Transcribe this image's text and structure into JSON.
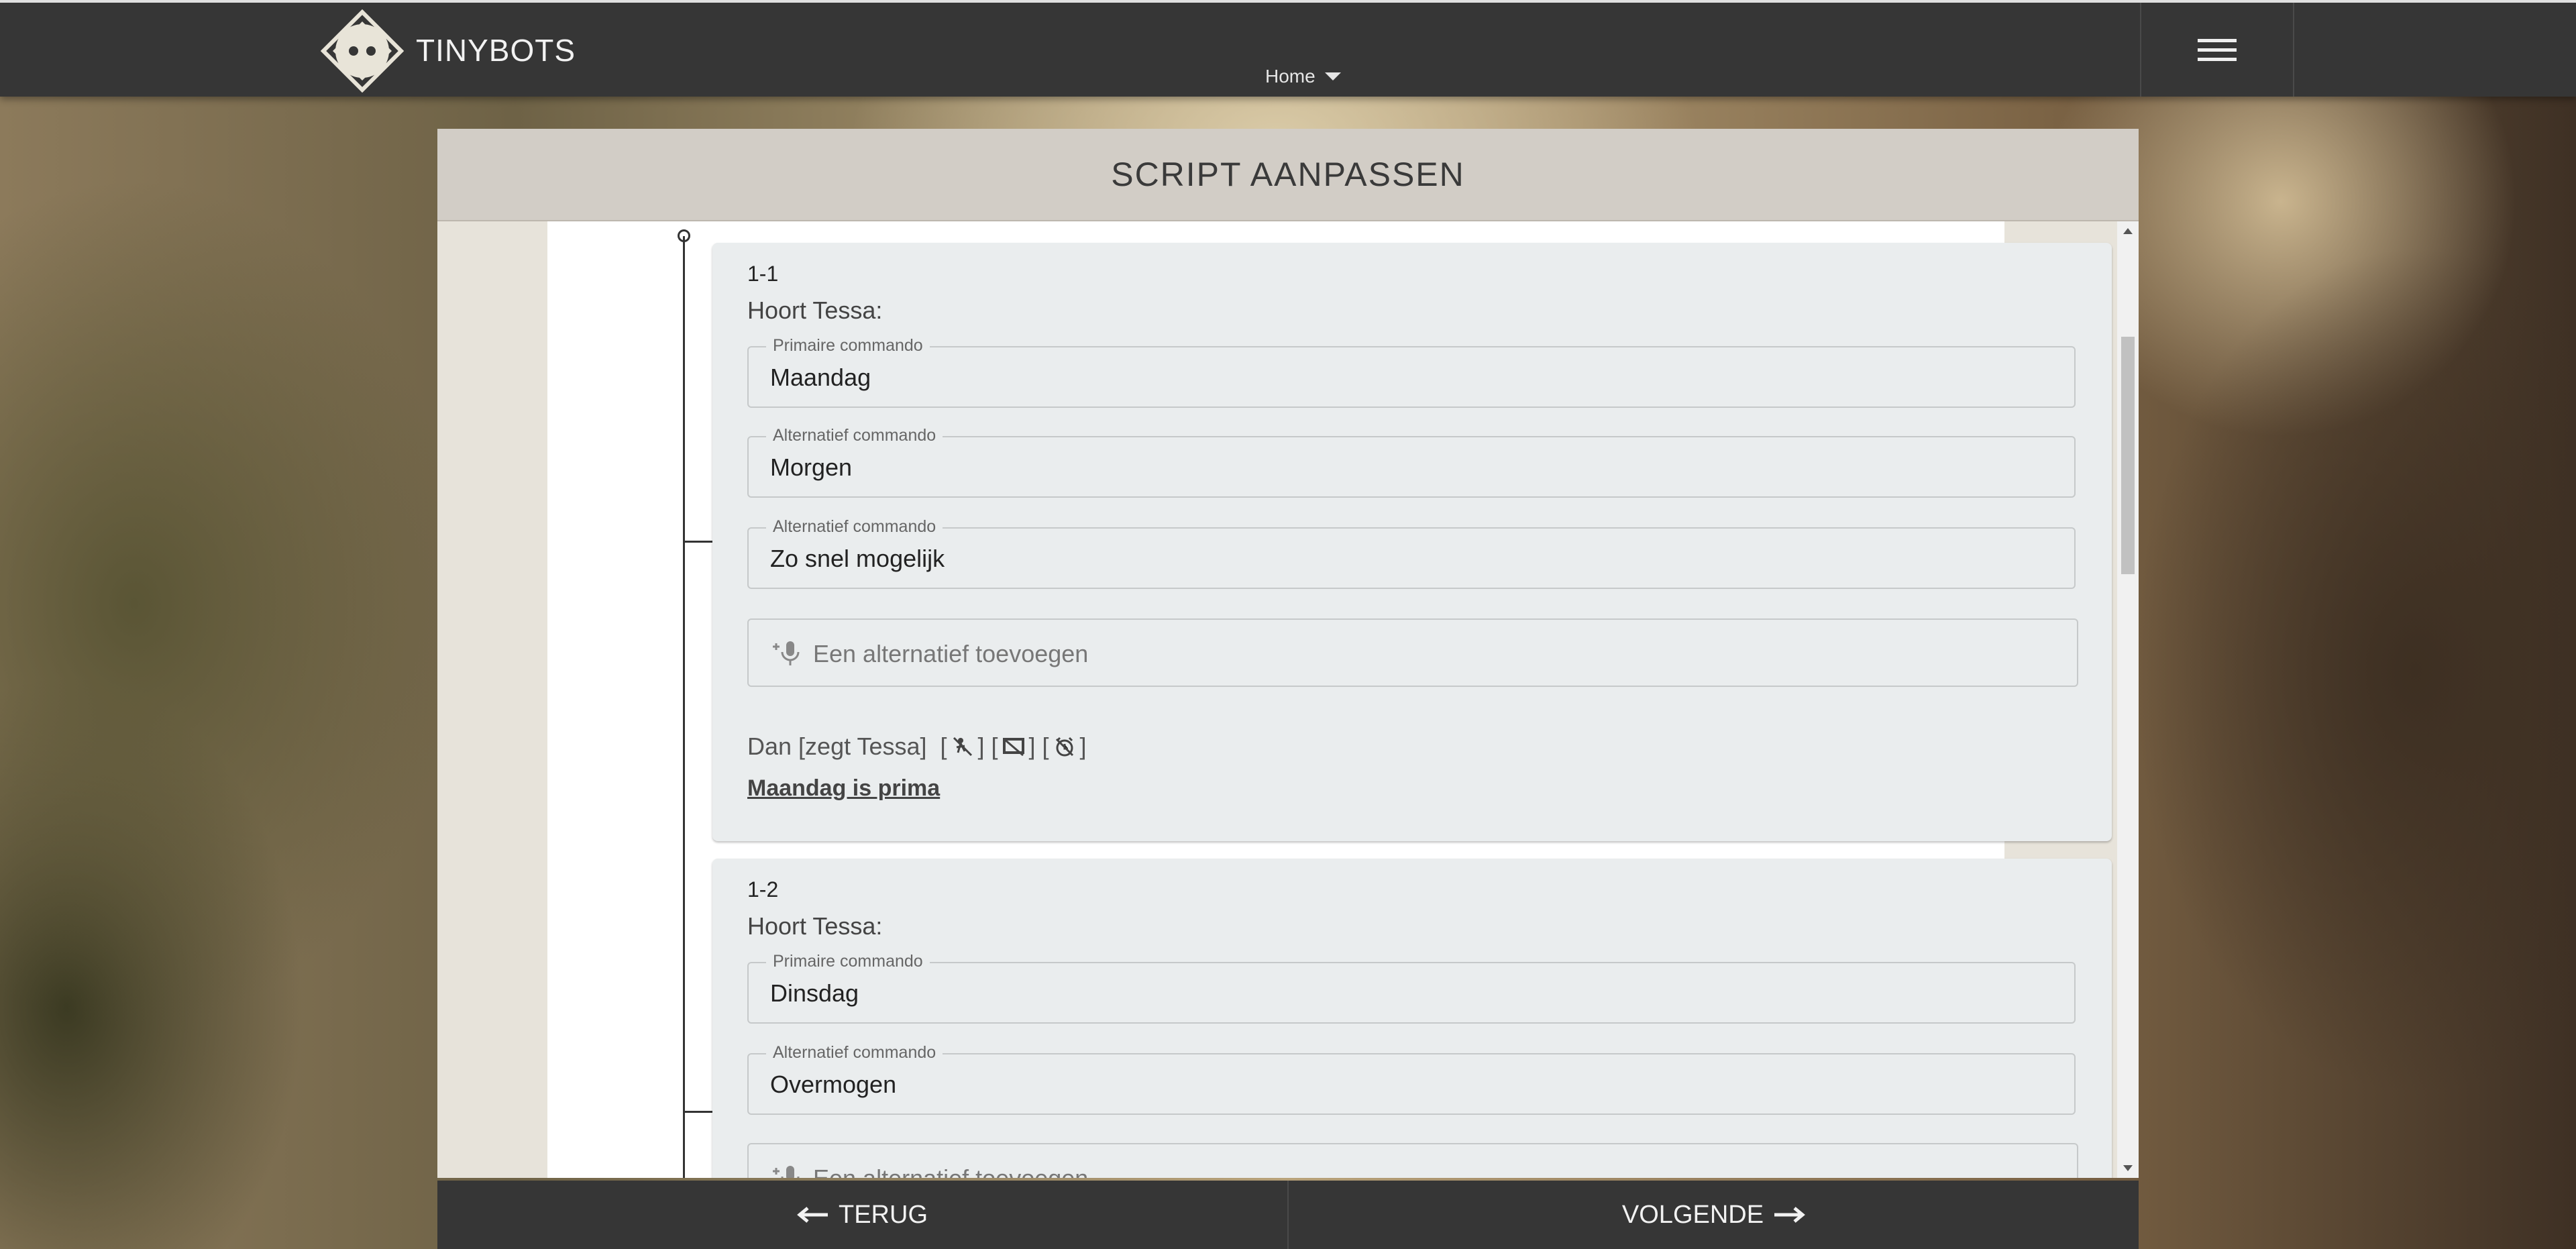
{
  "topbar": {
    "brand": "TINYBOTS",
    "home_label": "Home"
  },
  "panel": {
    "title": "SCRIPT AANPASSEN"
  },
  "cards": [
    {
      "code": "1-1",
      "hears_label": "Hoort Tessa:",
      "primary_label": "Primaire commando",
      "primary_value": "Maandag",
      "alt_label_1": "Alternatief commando",
      "alt_value_1": "Morgen",
      "alt_label_2": "Alternatief commando",
      "alt_value_2": "Zo snel mogelijk",
      "add_alt_placeholder": "Een alternatief toevoegen",
      "then_text": "Dan [zegt Tessa]",
      "says_text": "Maandag is prima"
    },
    {
      "code": "1-2",
      "hears_label": "Hoort Tessa:",
      "primary_label": "Primaire commando",
      "primary_value": "Dinsdag",
      "alt_label_1": "Alternatief commando",
      "alt_value_1": "Overmogen",
      "add_alt_placeholder": "Een alternatief toevoegen"
    }
  ],
  "footer": {
    "back_label": "TERUG",
    "next_label": "VOLGENDE"
  },
  "icons": {
    "logo": "tinybots-logo-icon",
    "menu": "hamburger-menu-icon",
    "mic": "add-mic-icon",
    "no_move": "no-move-icon",
    "no_screen": "no-screen-icon",
    "no_alarm": "no-alarm-icon"
  }
}
